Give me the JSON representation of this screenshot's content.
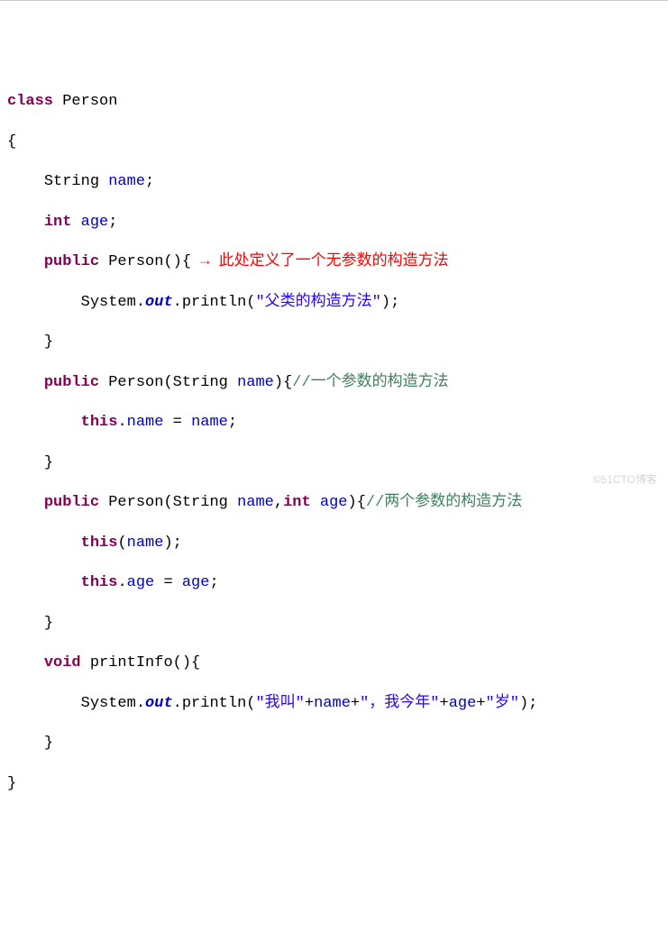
{
  "code": {
    "line1": {
      "kw_class": "class",
      "classname": "Person"
    },
    "line2": {
      "brace": "{"
    },
    "line3": {
      "indent": "    ",
      "type": "String",
      "name": "name",
      "semi": ";"
    },
    "line4": {
      "indent": "    ",
      "type": "int",
      "name": "age",
      "semi": ";"
    },
    "line5": {
      "indent": "    ",
      "modifier": "public",
      "ctor": "Person(){",
      "arrow": "→",
      "annotation": " 此处定义了一个无参数的构造方法"
    },
    "line6": {
      "indent": "        ",
      "sys": "System.",
      "out": "out",
      "dot": ".println(",
      "str": "\"父类的构造方法\"",
      "end": ");"
    },
    "line7": {
      "indent": "    ",
      "brace": "}"
    },
    "line8": {
      "indent": "    ",
      "modifier": "public",
      "ctor": " Person(String ",
      "param": "name",
      "close": "){",
      "comment": "//一个参数的构造方法"
    },
    "line9": {
      "indent": "        ",
      "this": "this",
      "dot": ".",
      "field": "name",
      "eq": " = ",
      "param": "name",
      "semi": ";"
    },
    "line10": {
      "indent": "    ",
      "brace": "}"
    },
    "line11": {
      "indent": "    ",
      "modifier": "public",
      "ctor": " Person(String ",
      "param1": "name",
      "comma": ",",
      "int": "int",
      "sp": " ",
      "param2": "age",
      "close": "){",
      "comment": "//两个参数的构造方法"
    },
    "line12": {
      "indent": "        ",
      "this": "this",
      "open": "(",
      "param": "name",
      "close": ");"
    },
    "line13": {
      "indent": "        ",
      "this": "this",
      "dot": ".",
      "field": "age",
      "eq": " = ",
      "param": "age",
      "semi": ";"
    },
    "line14": {
      "indent": "    ",
      "brace": "}"
    },
    "line15": {
      "indent": "    ",
      "ret": "void",
      "name": " printInfo(){"
    },
    "line16": {
      "indent": "        ",
      "sys": "System.",
      "out": "out",
      "dot": ".println(",
      "s1": "\"我叫\"",
      "p1": "+",
      "v1": "name",
      "p2": "+",
      "s2": "\"，我今年\"",
      "p3": "+",
      "v2": "age",
      "p4": "+",
      "s3": "\"岁\"",
      "end": ");"
    },
    "line17": {
      "indent": "    ",
      "brace": "}"
    },
    "line18": {
      "brace": "}"
    }
  },
  "watermark": "©51CTO博客"
}
